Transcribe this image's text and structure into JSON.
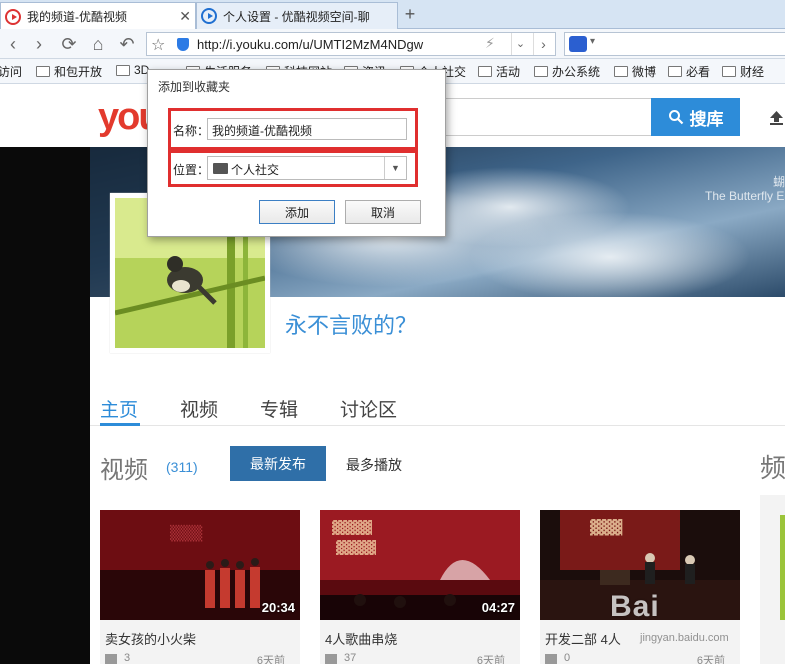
{
  "browser": {
    "tabs": [
      {
        "title": "我的频道-优酷视频",
        "active": true
      },
      {
        "title": "个人设置 - 优酷视频空间-聊",
        "active": false
      }
    ],
    "new_tab": "+",
    "close": "✕",
    "address_url": "http://i.youku.com/u/UMTI2MzM4NDgw"
  },
  "bookmarks": [
    "访问",
    "和包开放",
    "3D",
    "生活服务",
    "科技网站",
    "资讯",
    "个人社交",
    "活动",
    "办公系统",
    "微博",
    "必看",
    "财经"
  ],
  "site": {
    "logo": "you",
    "search_button": "搜库",
    "banner_cn": "蝴",
    "banner_en": "The Butterfly E",
    "username": "永不言败的？",
    "nav_tabs": [
      "主页",
      "视频",
      "专辑",
      "讨论区"
    ],
    "section_title": "视频",
    "section_count": "(311)",
    "sort_latest": "最新发布",
    "sort_most": "最多播放",
    "section_title_2": "频"
  },
  "videos": [
    {
      "title": "卖女孩的小火柴",
      "duration": "20:34",
      "plays": "3",
      "time": "6天前"
    },
    {
      "title": "4人歌曲串烧",
      "duration": "04:27",
      "plays": "37",
      "time": "6天前"
    },
    {
      "title": "开发二部 4人",
      "duration": "",
      "plays": "0",
      "time": "6天前"
    }
  ],
  "dialog": {
    "title": "添加到收藏夹",
    "name_label": "名称：",
    "name_value": "我的频道-优酷视频",
    "location_label": "位置：",
    "location_value": "个人社交",
    "add_button": "添加",
    "cancel_button": "取消"
  },
  "watermark": {
    "text": "Bai",
    "sub": "jingyan.baidu.com"
  }
}
